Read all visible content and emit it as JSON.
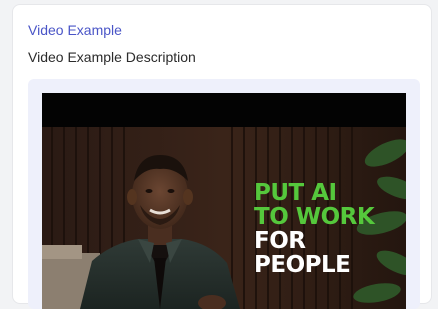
{
  "card": {
    "title": "Video Example",
    "description": "Video Example Description"
  },
  "video": {
    "headline_lines": [
      "PUT AI",
      "TO WORK",
      "FOR",
      "PEOPLE"
    ],
    "headline_colors": {
      "green": "#55c83c",
      "white": "#ffffff"
    }
  },
  "colors": {
    "link": "#4a55c7",
    "text": "#2b2b2b",
    "video_bg_panel": "#eef0fb",
    "page_bg": "#f2f3f5"
  }
}
